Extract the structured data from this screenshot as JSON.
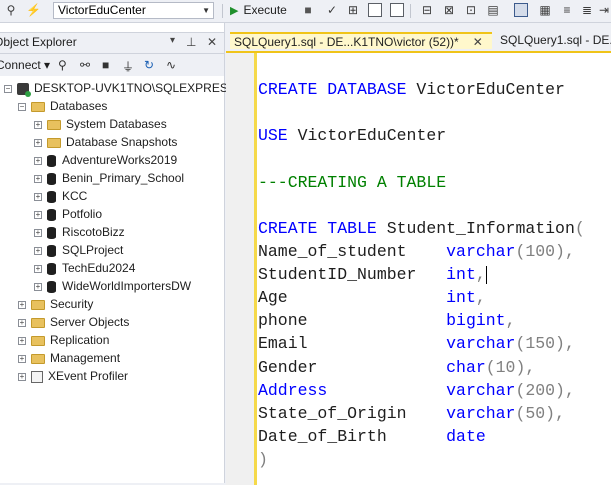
{
  "toolbar": {
    "database": "VictorEduCenter",
    "execute_label": "Execute"
  },
  "object_explorer": {
    "title": "Object Explorer",
    "connect_label": "Connect",
    "server": "DESKTOP-UVK1TNO\\SQLEXPRESS01",
    "databases_label": "Databases",
    "database_children": [
      {
        "label": "System Databases",
        "kind": "folder"
      },
      {
        "label": "Database Snapshots",
        "kind": "folder"
      },
      {
        "label": "AdventureWorks2019",
        "kind": "db"
      },
      {
        "label": "Benin_Primary_School",
        "kind": "db"
      },
      {
        "label": "KCC",
        "kind": "db"
      },
      {
        "label": "Potfolio",
        "kind": "db"
      },
      {
        "label": "RiscotoBizz",
        "kind": "db"
      },
      {
        "label": "SQLProject",
        "kind": "db"
      },
      {
        "label": "TechEdu2024",
        "kind": "db"
      },
      {
        "label": "WideWorldImportersDW",
        "kind": "db"
      }
    ],
    "server_children": [
      {
        "label": "Security",
        "kind": "folder"
      },
      {
        "label": "Server Objects",
        "kind": "folder"
      },
      {
        "label": "Replication",
        "kind": "folder"
      },
      {
        "label": "Management",
        "kind": "folder"
      },
      {
        "label": "XEvent Profiler",
        "kind": "xevent"
      }
    ]
  },
  "tabs": [
    {
      "label": "SQLQuery1.sql - DE...K1TNO\\victor (52))*",
      "active": true
    },
    {
      "label": "SQLQuery1.sql - DE...",
      "active": false
    }
  ],
  "code": {
    "line1": {
      "kw": "CREATE DATABASE",
      "name": " VictorEduCenter"
    },
    "line2": {
      "kw": "USE",
      "name": " VictorEduCenter"
    },
    "line3": {
      "comment": "---CREATING A TABLE"
    },
    "line4": {
      "kw": "CREATE TABLE",
      "name": " Student_Information",
      "paren": "("
    },
    "columns": [
      {
        "name": "Name_of_student    ",
        "type": "varchar",
        "arg": "(100)",
        "end": ","
      },
      {
        "name": "StudentID_Number   ",
        "type": "int",
        "arg": "",
        "end": ","
      },
      {
        "name": "Age                ",
        "type": "int",
        "arg": "",
        "end": ","
      },
      {
        "name": "phone              ",
        "type": "bigint",
        "arg": "",
        "end": ","
      },
      {
        "name": "Email              ",
        "type": "varchar",
        "arg": "(150)",
        "end": ","
      },
      {
        "name": "Gender             ",
        "type": "char",
        "arg": "(10)",
        "end": ","
      },
      {
        "name": "Address            ",
        "type": "varchar",
        "arg": "(200)",
        "end": ",",
        "name_is_kw": true
      },
      {
        "name": "State_of_Origin    ",
        "type": "varchar",
        "arg": "(50)",
        "end": ","
      },
      {
        "name": "Date_of_Birth      ",
        "type": "date",
        "arg": "",
        "end": ""
      }
    ],
    "close_paren": ")"
  }
}
